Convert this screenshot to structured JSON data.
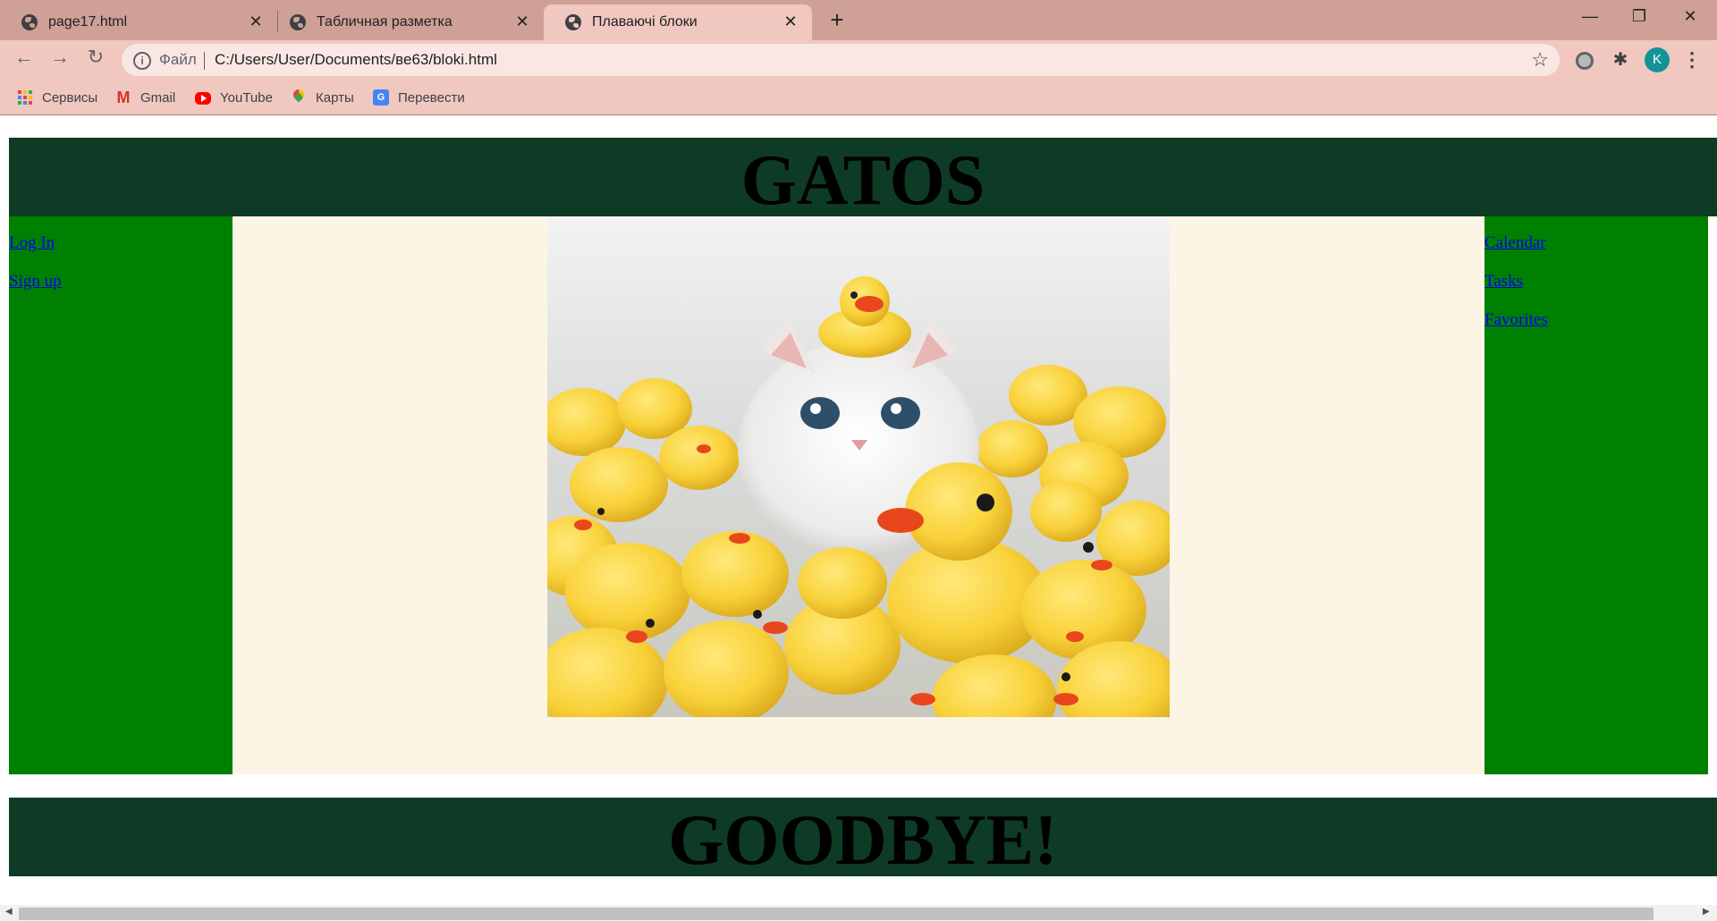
{
  "browser": {
    "tabs": [
      {
        "title": "page17.html",
        "active": false
      },
      {
        "title": "Табличная разметка",
        "active": false
      },
      {
        "title": "Плаваючі блоки",
        "active": true
      }
    ],
    "new_tab_label": "+",
    "close_glyph": "✕",
    "window_controls": {
      "minimize": "—",
      "restore": "❐",
      "close": "✕"
    },
    "nav": {
      "back": "←",
      "forward": "→",
      "reload": "↻"
    },
    "address": {
      "scheme_label": "Файл",
      "url": "C:/Users/User/Documents/ве63/bloki.html",
      "info_glyph": "i",
      "star_glyph": "☆"
    },
    "toolbar_icons": [
      "extension-circle-icon",
      "puzzle-icon",
      "profile-avatar",
      "kebab-menu-icon"
    ],
    "avatar_letter": "K",
    "menu_glyph": "⋮",
    "puzzle_glyph": "✱",
    "bookmarks": [
      {
        "label": "Сервисы",
        "icon": "apps-grid-icon"
      },
      {
        "label": "Gmail",
        "icon": "gmail-icon"
      },
      {
        "label": "YouTube",
        "icon": "youtube-icon"
      },
      {
        "label": "Карты",
        "icon": "maps-pin-icon"
      },
      {
        "label": "Перевести",
        "icon": "translate-icon"
      }
    ],
    "gmail_glyph": "M",
    "translate_glyph": "G"
  },
  "page": {
    "header_title": "GATOS",
    "footer_title": "GOODBYE!",
    "left_links": [
      "Log In",
      "Sign up"
    ],
    "right_links": [
      "Calendar",
      "Tasks",
      "Favorites"
    ],
    "image_subject": "white kitten among yellow rubber ducks"
  },
  "colors": {
    "header_bg": "#0e3b25",
    "sidebar_bg": "#008000",
    "center_bg": "#fcf5e5",
    "link": "#0000ee",
    "tabbar": "#cfa095",
    "toolbar": "#f0c8c0"
  }
}
